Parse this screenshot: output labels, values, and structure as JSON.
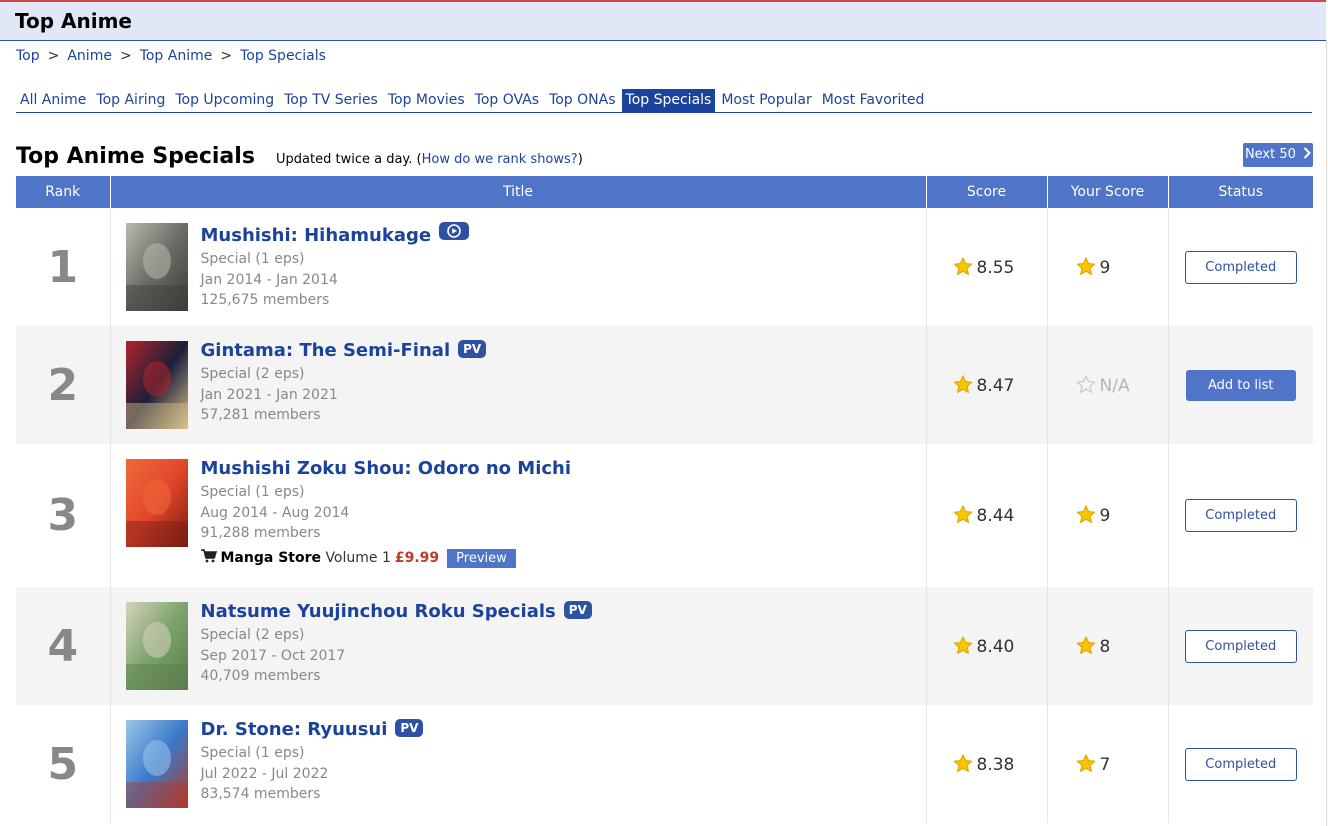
{
  "page_title": "Top Anime",
  "breadcrumb": [
    "Top",
    "Anime",
    "Top Anime",
    "Top Specials"
  ],
  "breadcrumb_sep": ">",
  "tabs": [
    {
      "label": "All Anime"
    },
    {
      "label": "Top Airing"
    },
    {
      "label": "Top Upcoming"
    },
    {
      "label": "Top TV Series"
    },
    {
      "label": "Top Movies"
    },
    {
      "label": "Top OVAs"
    },
    {
      "label": "Top ONAs"
    },
    {
      "label": "Top Specials",
      "active": true
    },
    {
      "label": "Most Popular"
    },
    {
      "label": "Most Favorited"
    }
  ],
  "section_title": "Top Anime Specials",
  "updated_text": "Updated twice a day.",
  "rank_link": "How do we rank shows?",
  "next_label": "Next 50",
  "columns": [
    "Rank",
    "Title",
    "Score",
    "Your Score",
    "Status"
  ],
  "rows": [
    {
      "rank": "1",
      "title": "Mushishi: Hihamukage",
      "badge": "play",
      "type": "Special (1 eps)",
      "dates": "Jan 2014 - Jan 2014",
      "members": "125,675 members",
      "score": "8.55",
      "your_score": "9",
      "status": "Completed",
      "thumb_colors": [
        "#6b6b66",
        "#b9b9b0",
        "#3c3d38"
      ]
    },
    {
      "rank": "2",
      "title": "Gintama: The Semi-Final",
      "badge": "PV",
      "type": "Special (2 eps)",
      "dates": "Jan 2021 - Jan 2021",
      "members": "57,281 members",
      "score": "8.47",
      "your_score": "N/A",
      "status": "Add to list",
      "thumb_colors": [
        "#1b1f3a",
        "#b3242a",
        "#d9c08a"
      ]
    },
    {
      "rank": "3",
      "title": "Mushishi Zoku Shou: Odoro no Michi",
      "badge": "",
      "type": "Special (1 eps)",
      "dates": "Aug 2014 - Aug 2014",
      "members": "91,288 members",
      "score": "8.44",
      "your_score": "9",
      "status": "Completed",
      "thumb_colors": [
        "#e2462a",
        "#f06a3c",
        "#7a1d13"
      ],
      "store": {
        "label": "Manga Store",
        "volume": "Volume 1",
        "price": "£9.99",
        "preview": "Preview"
      }
    },
    {
      "rank": "4",
      "title": "Natsume Yuujinchou Roku Specials",
      "badge": "PV",
      "type": "Special (2 eps)",
      "dates": "Sep 2017 - Oct 2017",
      "members": "40,709 members",
      "score": "8.40",
      "your_score": "8",
      "status": "Completed",
      "thumb_colors": [
        "#7aa36a",
        "#d8d2bd",
        "#5d7d4e"
      ]
    },
    {
      "rank": "5",
      "title": "Dr. Stone: Ryuusui",
      "badge": "PV",
      "type": "Special (1 eps)",
      "dates": "Jul 2022 - Jul 2022",
      "members": "83,574 members",
      "score": "8.38",
      "your_score": "7",
      "status": "Completed",
      "thumb_colors": [
        "#3a79c9",
        "#9cc6ea",
        "#b13a2a"
      ]
    }
  ],
  "colors": {
    "accent": "#4f74c8",
    "link": "#1c439b",
    "header_bg": "#e1e7f5",
    "star": "#f7c600",
    "price": "#c0392b"
  }
}
